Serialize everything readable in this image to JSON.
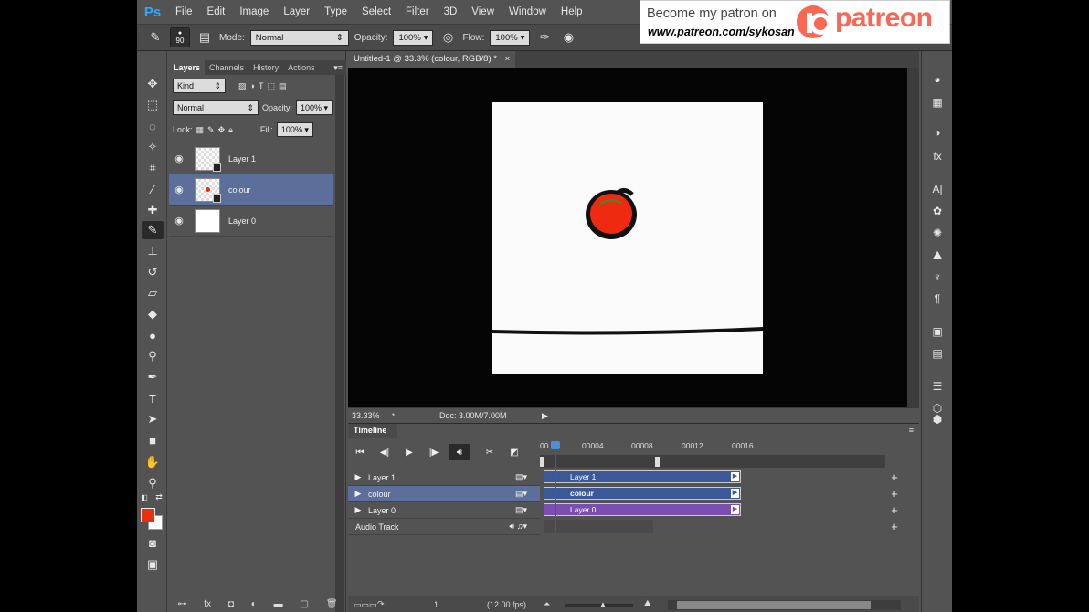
{
  "app": {
    "logo": "Ps"
  },
  "menu": [
    "File",
    "Edit",
    "Image",
    "Layer",
    "Type",
    "Select",
    "Filter",
    "3D",
    "View",
    "Window",
    "Help"
  ],
  "options": {
    "brush_size": "90",
    "mode_label": "Mode:",
    "mode_value": "Normal",
    "opacity_label": "Opacity:",
    "opacity_value": "100%",
    "flow_label": "Flow:",
    "flow_value": "100%"
  },
  "patreon": {
    "become": "Become my patron on",
    "url": "www.patreon.com/sykosan",
    "brand": "patreon"
  },
  "layers_panel": {
    "tabs": [
      "Layers",
      "Channels",
      "History",
      "Actions"
    ],
    "kind_label": "Kind",
    "blend_mode": "Normal",
    "opacity_label": "Opacity:",
    "opacity_value": "100%",
    "lock_label": "Lock:",
    "fill_label": "Fill:",
    "fill_value": "100%",
    "layers": [
      {
        "name": "Layer 1"
      },
      {
        "name": "colour"
      },
      {
        "name": "Layer 0"
      }
    ]
  },
  "document": {
    "tab_title": "Untitled-1 @ 33.3% (colour, RGB/8) *",
    "close_glyph": "×"
  },
  "status": {
    "zoom": "33.33%",
    "doc": "Doc: 3.00M/7.00M"
  },
  "timeline": {
    "title": "Timeline",
    "ruler": [
      "00",
      "00004",
      "00008",
      "00012",
      "00016"
    ],
    "tracks": [
      {
        "name": "Layer 1"
      },
      {
        "name": "colour"
      },
      {
        "name": "Layer 0"
      }
    ],
    "audio_track": "Audio Track",
    "frame": "1",
    "fps": "(12.00 fps)"
  },
  "colors": {
    "foreground": "#e8300c",
    "background": "#ffffff",
    "selected_row": "#5c6f9b",
    "clip_blue": "#3b5998",
    "clip_purple": "#7b4fb0",
    "playhead": "#e0201c"
  }
}
